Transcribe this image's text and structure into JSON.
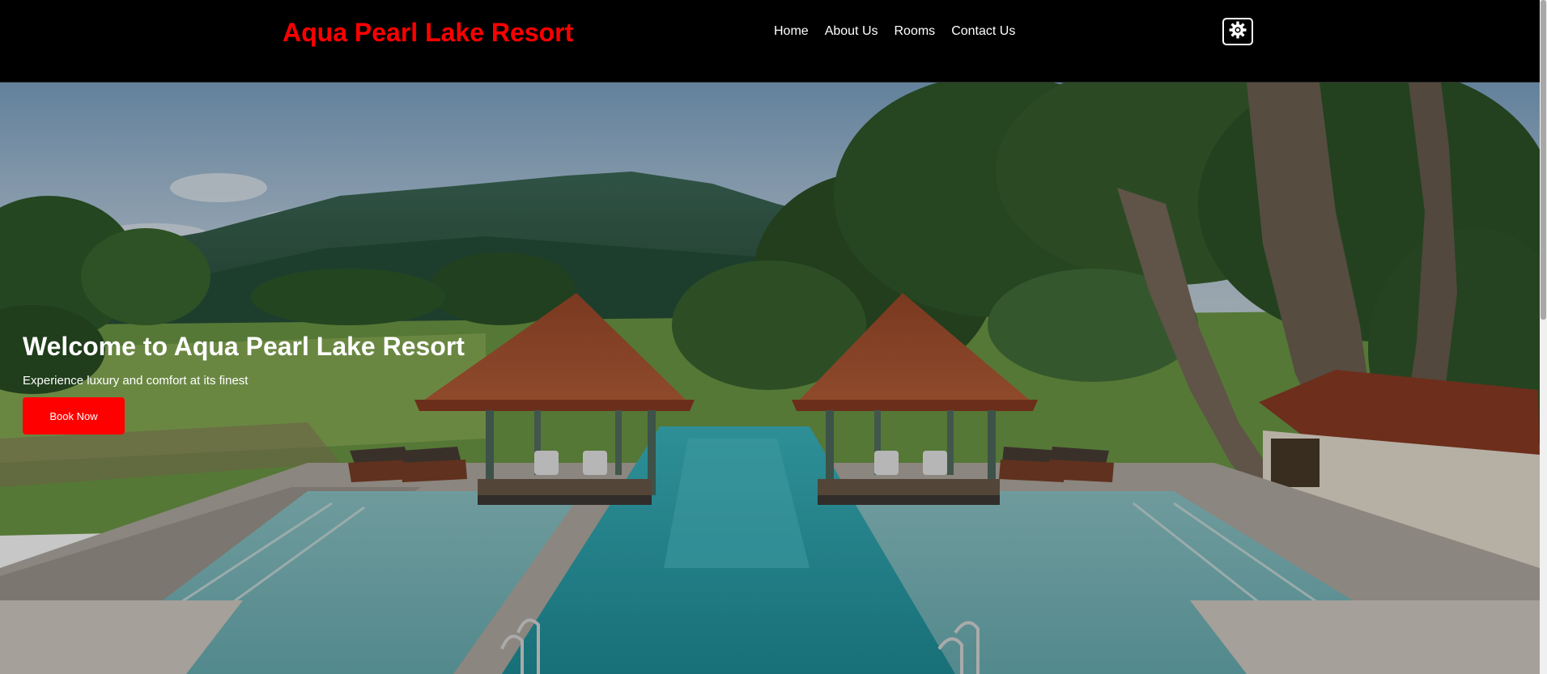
{
  "header": {
    "brand": "Aqua Pearl Lake Resort",
    "nav": {
      "home": "Home",
      "about": "About Us",
      "rooms": "Rooms",
      "contact": "Contact Us"
    },
    "theme_toggle_icon": "gear-icon"
  },
  "hero": {
    "title": "Welcome to Aqua Pearl Lake Resort",
    "subtitle": "Experience luxury and comfort at its finest",
    "cta_label": "Book Now"
  },
  "colors": {
    "brand": "#ff0000",
    "header_bg": "#000000",
    "cta_bg": "#ff0000",
    "text_light": "#ffffff"
  }
}
